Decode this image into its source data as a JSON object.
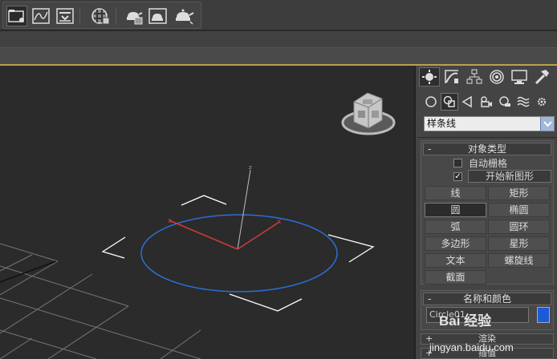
{
  "toolbar": {
    "icons": [
      "project-folder-icon",
      "curve-editor-icon",
      "schematic-view-icon",
      "material-editor-icon",
      "render-setup-icon",
      "rendered-frame-icon",
      "render-icon"
    ]
  },
  "viewport": {
    "gizmo_axis_label": "z"
  },
  "panel": {
    "tabs": [
      "create-tab",
      "modify-tab",
      "hierarchy-tab",
      "motion-tab",
      "display-tab",
      "utilities-tab"
    ],
    "category_dropdown": "样条线",
    "object_type": {
      "header": "对象类型",
      "auto_grid": "自动栅格",
      "start_new_shape": "开始新图形",
      "buttons": [
        "线",
        "矩形",
        "圆",
        "椭圆",
        "弧",
        "圆环",
        "多边形",
        "星形",
        "文本",
        "螺旋线",
        "截面"
      ],
      "selected": "圆"
    },
    "name_color": {
      "header": "名称和颜色",
      "name_value": "Circle01",
      "swatch_color": "#1c5bd8"
    },
    "rendering_label": "渲染",
    "interpolation_label": "插值"
  },
  "watermark": {
    "logo": "Bai 经验",
    "url": "jingyan.baidu.com"
  },
  "colors": {
    "accent_line": "#b8a24a",
    "circle_blue": "#2b6fd6",
    "axis_red": "#d23b3b"
  }
}
